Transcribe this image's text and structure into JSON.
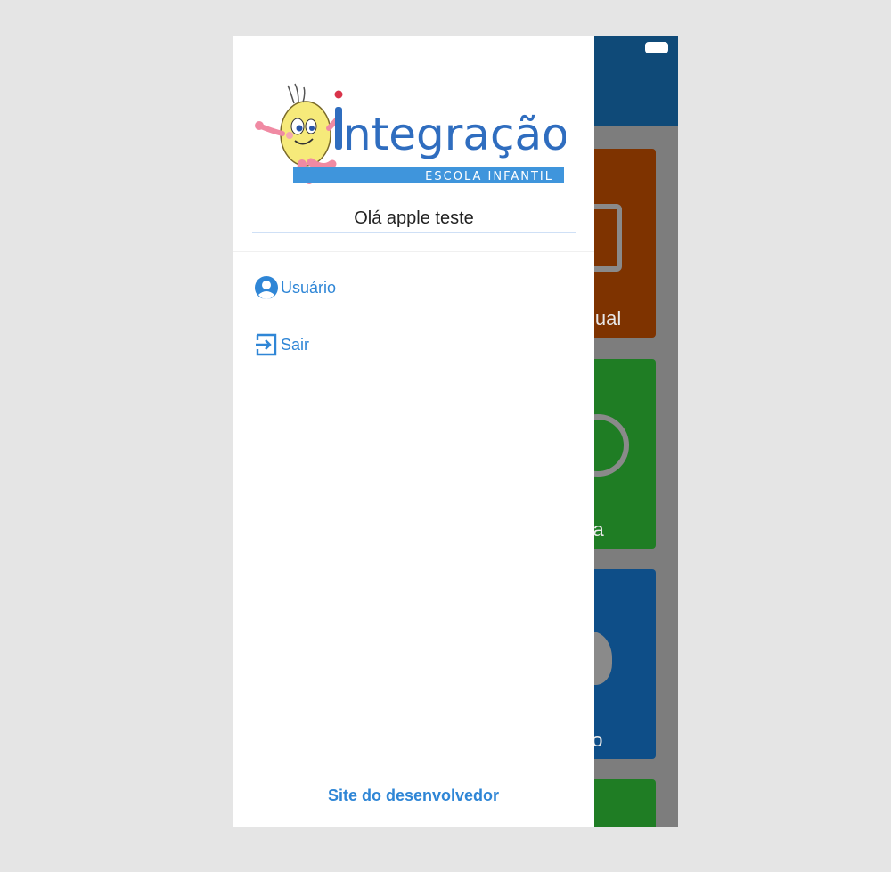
{
  "drawer": {
    "logo": {
      "brand_name": "integração",
      "subtitle": "ESCOLA INFANTIL",
      "brand_color": "#2f6dbf",
      "banner_color": "#3f95dc"
    },
    "greeting": "Olá apple teste",
    "menu": [
      {
        "label": "Usuário",
        "icon": "user-circle-icon"
      },
      {
        "label": "Sair",
        "icon": "logout-icon"
      }
    ],
    "footer_link": "Site do desenvolvedor"
  },
  "background_app": {
    "cards": [
      {
        "label": "Anual",
        "color": "#d35400"
      },
      {
        "label": "aria",
        "color": "#2e9e33"
      },
      {
        "label": "ção",
        "color": "#1565c0"
      },
      {
        "label": "",
        "color": "#2e9e33"
      }
    ]
  },
  "colors": {
    "accent": "#2f86d6",
    "header": "#1a5f9e"
  }
}
